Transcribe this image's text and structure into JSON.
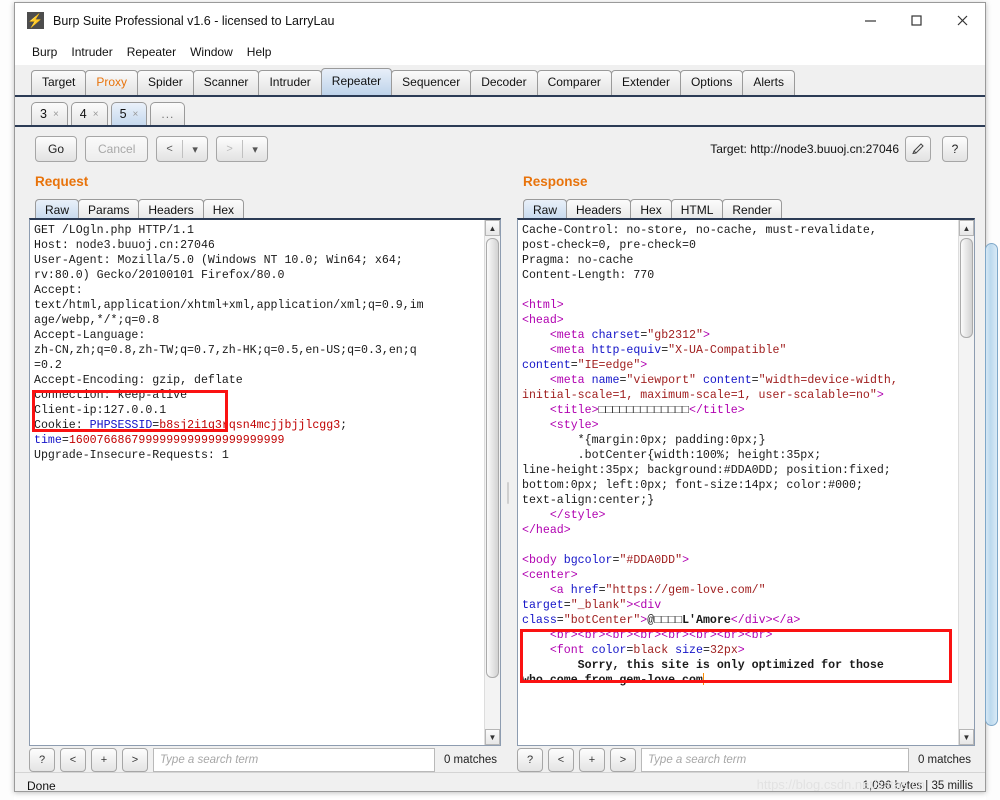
{
  "window": {
    "title": "Burp Suite Professional v1.6 - licensed to LarryLau",
    "icon": "burp-bolt-icon",
    "minimize": "–",
    "maximize": "□",
    "close": "✕"
  },
  "menubar": {
    "items": [
      "Burp",
      "Intruder",
      "Repeater",
      "Window",
      "Help"
    ]
  },
  "main_tabs": {
    "items": [
      {
        "label": "Target",
        "state": "normal"
      },
      {
        "label": "Proxy",
        "state": "orange"
      },
      {
        "label": "Spider",
        "state": "normal"
      },
      {
        "label": "Scanner",
        "state": "normal"
      },
      {
        "label": "Intruder",
        "state": "normal"
      },
      {
        "label": "Repeater",
        "state": "selected"
      },
      {
        "label": "Sequencer",
        "state": "normal"
      },
      {
        "label": "Decoder",
        "state": "normal"
      },
      {
        "label": "Comparer",
        "state": "normal"
      },
      {
        "label": "Extender",
        "state": "normal"
      },
      {
        "label": "Options",
        "state": "normal"
      },
      {
        "label": "Alerts",
        "state": "normal"
      }
    ]
  },
  "sub_tabs": {
    "items": [
      {
        "label": "3",
        "close": "×",
        "state": "normal"
      },
      {
        "label": "4",
        "close": "×",
        "state": "normal"
      },
      {
        "label": "5",
        "close": "×",
        "state": "selected"
      }
    ],
    "more": "..."
  },
  "toolbar": {
    "go": "Go",
    "cancel": "Cancel",
    "back_arrow": "<",
    "back_caret": "▾",
    "forward_arrow": ">",
    "forward_caret": "▾",
    "target_label": "Target: http://node3.buuoj.cn:27046",
    "edit_icon": "pencil-icon",
    "help_icon": "?"
  },
  "request": {
    "title": "Request",
    "tabs": [
      {
        "label": "Raw",
        "state": "selected"
      },
      {
        "label": "Params",
        "state": "normal"
      },
      {
        "label": "Headers",
        "state": "normal"
      },
      {
        "label": "Hex",
        "state": "normal"
      }
    ],
    "lines": [
      "GET /LOgln.php HTTP/1.1",
      "Host: node3.buuoj.cn:27046",
      "User-Agent: Mozilla/5.0 (Windows NT 10.0; Win64; x64;",
      "rv:80.0) Gecko/20100101 Firefox/80.0",
      "Accept:",
      "text/html,application/xhtml+xml,application/xml;q=0.9,im",
      "age/webp,*/*;q=0.8",
      "Accept-Language:",
      "zh-CN,zh;q=0.8,zh-TW;q=0.7,zh-HK;q=0.5,en-US;q=0.3,en;q",
      "=0.2",
      "Accept-Encoding: gzip, deflate",
      "Connection: keep-alive",
      "Client-ip:127.0.0.1",
      "Cookie: PHPSESSID=b8sj2i1q3rqsn4mcjjbjjlcgg3;",
      "time=1600766867999999999999999999999",
      "Upgrade-Insecure-Requests: 1"
    ],
    "highlight_note": "Client-ip:127.0.0.1",
    "search": {
      "help": "?",
      "prev": "<",
      "add": "+",
      "next": ">",
      "placeholder": "Type a search term",
      "value": "",
      "matches": "0 matches"
    }
  },
  "response": {
    "title": "Response",
    "tabs": [
      {
        "label": "Raw",
        "state": "selected"
      },
      {
        "label": "Headers",
        "state": "normal"
      },
      {
        "label": "Hex",
        "state": "normal"
      },
      {
        "label": "HTML",
        "state": "normal"
      },
      {
        "label": "Render",
        "state": "normal"
      }
    ],
    "header_lines": [
      "Cache-Control: no-store, no-cache, must-revalidate,",
      "post-check=0, pre-check=0",
      "Pragma: no-cache",
      "Content-Length: 770"
    ],
    "body_title_boxes": "□□□□□□□□□□□□□",
    "body_brand_boxes": "□□□□",
    "body_brand_text": "L'Amore",
    "highlight_note": "Sorry, this site is only optimized for those who come from gem-love.com",
    "search": {
      "help": "?",
      "prev": "<",
      "add": "+",
      "next": ">",
      "placeholder": "Type a search term",
      "value": "",
      "matches": "0 matches"
    }
  },
  "statusbar": {
    "left": "Done",
    "right": "1,096 bytes | 35 millis",
    "watermark": "https://blog.csdn.net/satas.cn"
  },
  "colors": {
    "accent_orange": "#e8730b",
    "annotation_red": "#fa1212",
    "tab_selected": "#c4d8ed",
    "syntax_tag": "#b000b0",
    "syntax_attr": "#1414c8",
    "syntax_value": "#a02020"
  }
}
